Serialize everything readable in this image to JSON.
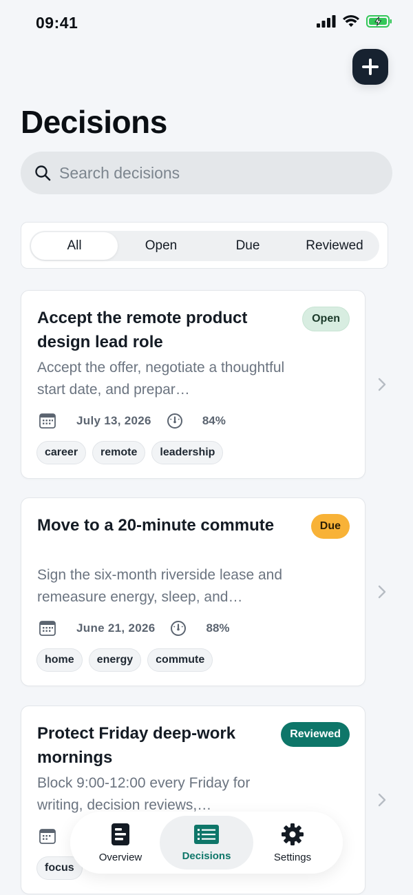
{
  "status_bar": {
    "time": "09:41"
  },
  "header": {
    "title": "Decisions",
    "add_icon": "plus-icon"
  },
  "search": {
    "placeholder": "Search decisions",
    "value": ""
  },
  "filters": {
    "selected": "All",
    "options": [
      "All",
      "Open",
      "Due",
      "Reviewed"
    ]
  },
  "colors": {
    "accent": "#0e7669",
    "open_badge": "#d8ede1",
    "due_badge": "#f8b237",
    "reviewed_badge": "#0e7669",
    "dark_button": "#172230"
  },
  "decisions": [
    {
      "title": "Accept the remote product design lead role",
      "status": "Open",
      "description": "Accept the offer, negotiate a thoughtful start date, and prepar…",
      "date": "July 13, 2026",
      "confidence": "84%",
      "tags": [
        "career",
        "remote",
        "leadership"
      ]
    },
    {
      "title": "Move to a 20-minute commute",
      "status": "Due",
      "description": "Sign the six-month riverside lease and remeasure energy, sleep, and…",
      "date": "June 21, 2026",
      "confidence": "88%",
      "tags": [
        "home",
        "energy",
        "commute"
      ]
    },
    {
      "title": "Protect Friday deep-work mornings",
      "status": "Reviewed",
      "description": "Block 9:00-12:00 every Friday for writing, decision reviews,…",
      "date": "",
      "confidence": "",
      "tags": [
        "focus"
      ]
    }
  ],
  "tabbar": {
    "tabs": [
      {
        "label": "Overview",
        "icon": "document-icon"
      },
      {
        "label": "Decisions",
        "icon": "list-icon",
        "active": true
      },
      {
        "label": "Settings",
        "icon": "gear-icon"
      }
    ]
  }
}
